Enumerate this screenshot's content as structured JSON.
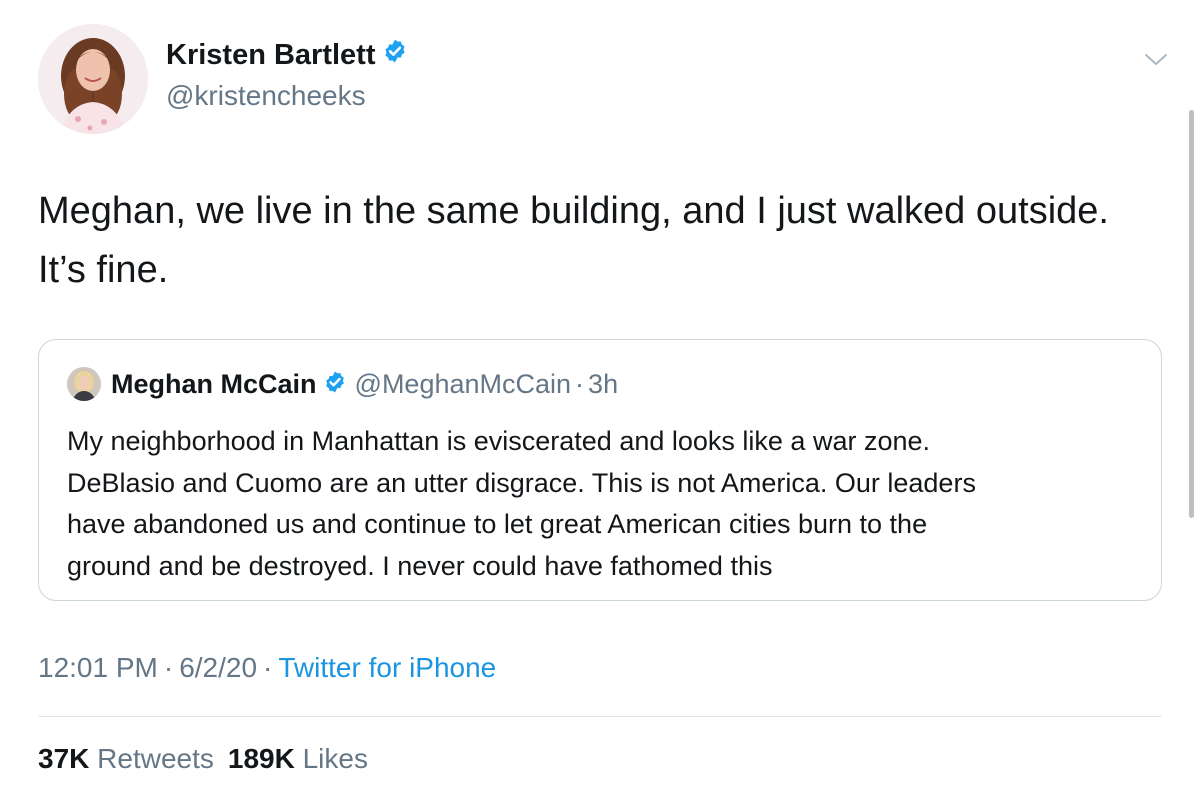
{
  "tweet": {
    "author_name": "Kristen Bartlett",
    "author_handle": "@kristencheeks",
    "text_line1": "Meghan, we live in the same building, and I just walked outside.",
    "text_line2": "It’s fine.",
    "timestamp_time": "12:01 PM",
    "timestamp_date": "6/2/20",
    "separator": "·",
    "source": "Twitter for iPhone",
    "retweets_count": "37K",
    "retweets_label": "Retweets",
    "likes_count": "189K",
    "likes_label": "Likes"
  },
  "quoted_tweet": {
    "author_name": "Meghan McCain",
    "author_handle": "@MeghanMcCain",
    "separator": "·",
    "time_ago": "3h",
    "text_line1": "My neighborhood in Manhattan is eviscerated and looks like a war zone.",
    "text_line2": "DeBlasio and Cuomo are an utter disgrace. This is not America. Our leaders",
    "text_line3": "have abandoned us and continue to let great American cities burn to the",
    "text_line4": "ground and be destroyed. I never could have fathomed this"
  },
  "icons": {
    "verified": "verified-badge-icon",
    "caret": "chevron-down-icon"
  },
  "colors": {
    "primary_text": "#14171a",
    "secondary_text": "#657786",
    "link": "#1b95e0",
    "verified": "#1da1f2",
    "border": "#ccd6dd",
    "divider": "#e1e8ed"
  }
}
